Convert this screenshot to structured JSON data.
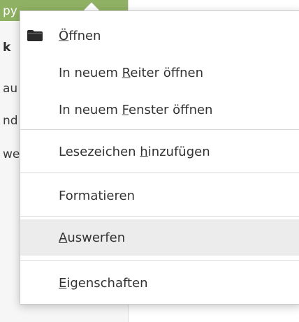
{
  "background": {
    "selected_item": "py",
    "rows": [
      "k",
      "au",
      "nd",
      "we"
    ]
  },
  "menu": {
    "items": [
      {
        "id": "open",
        "pre": "",
        "accel": "Ö",
        "post": "ffnen",
        "icon": "folder-icon"
      },
      {
        "id": "open-tab",
        "pre": "In neuem ",
        "accel": "R",
        "post": "eiter öffnen"
      },
      {
        "id": "open-window",
        "pre": "In neuem ",
        "accel": "F",
        "post": "enster öffnen"
      },
      {
        "id": "add-bookmark",
        "pre": "Lesezeichen ",
        "accel": "h",
        "post": "inzufügen"
      },
      {
        "id": "format",
        "pre": "Formatieren",
        "accel": "",
        "post": ""
      },
      {
        "id": "eject",
        "pre": "",
        "accel": "A",
        "post": "uswerfen",
        "highlighted": true
      },
      {
        "id": "properties",
        "pre": "",
        "accel": "E",
        "post": "igenschaften"
      }
    ]
  },
  "colors": {
    "selection": "#8fb163",
    "hover": "#ececec"
  }
}
